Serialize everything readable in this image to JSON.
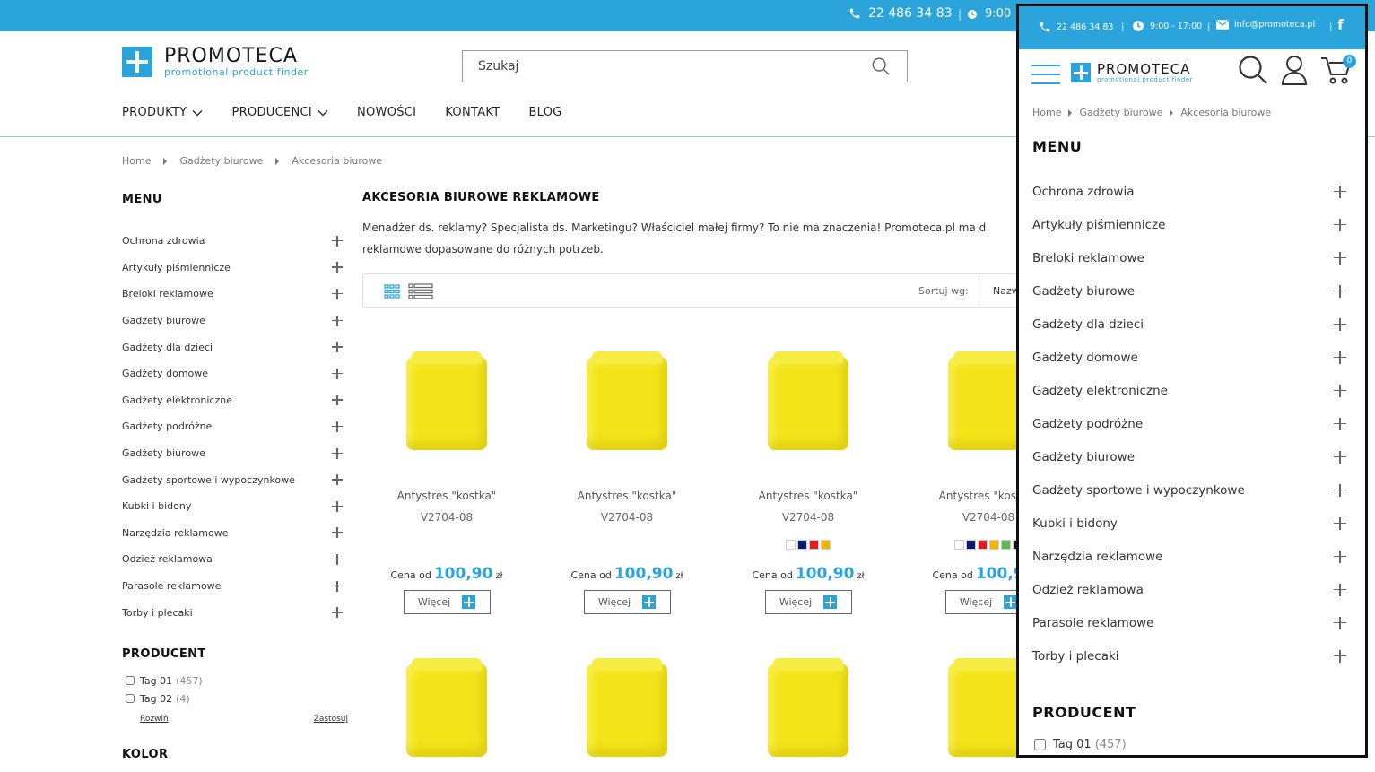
{
  "topbar": {
    "phone": "22 486 34 83",
    "hours": "9:00"
  },
  "logo": {
    "brand": "PROMOTECA",
    "tagline": "promotional product finder"
  },
  "search": {
    "placeholder": "Szukaj"
  },
  "nav": [
    {
      "label": "PRODUKTY",
      "has_dropdown": true
    },
    {
      "label": "PRODUCENCI",
      "has_dropdown": true
    },
    {
      "label": "NOWOŚCI",
      "has_dropdown": false
    },
    {
      "label": "KONTAKT",
      "has_dropdown": false
    },
    {
      "label": "BLOG",
      "has_dropdown": false
    }
  ],
  "breadcrumb": [
    "Home",
    "Gadżety biurowe",
    "Akcesoria biurowe"
  ],
  "sidebar": {
    "title": "MENU",
    "items": [
      "Ochrona zdrowia",
      "Artykuły piśmiennicze",
      "Breloki reklamowe",
      "Gadżety biurowe",
      "Gadżety dla dzieci",
      "Gadżety domowe",
      "Gadżety elektroniczne",
      "Gadżety podróżne",
      "Gadżety biurowe",
      "Gadżety sportowe i wypoczynkowe",
      "Kubki i bidony",
      "Narzędzia reklamowe",
      "Odzież reklamowa",
      "Parasole reklamowe",
      "Torby i plecaki"
    ]
  },
  "producent": {
    "title": "PRODUCENT",
    "tags": [
      {
        "label": "Tag 01",
        "count": "(457)"
      },
      {
        "label": "Tag 02",
        "count": "(4)"
      }
    ],
    "expand": "Rozwiń",
    "apply": "Zastosuj"
  },
  "kolor": {
    "title": "KOLOR"
  },
  "main": {
    "title": "AKCESORIA BIUROWE REKLAMOWE",
    "description": "Menadżer ds. reklamy? Specjalista ds. Marketingu? Właściciel małej firmy? To nie ma znaczenia! Promoteca.pl ma d reklamowe dopasowane do różnych potrzeb."
  },
  "toolbar": {
    "sort_label": "Sortuj wg:",
    "sort_value": "Nazw"
  },
  "products": [
    {
      "name": "Antystres \"kostka\"",
      "code": "V2704-08",
      "price_prefix": "Cena od",
      "price": "100,90",
      "currency": "zł",
      "swatches": [],
      "more": "Więcej"
    },
    {
      "name": "Antystres \"kostka\"",
      "code": "V2704-08",
      "price_prefix": "Cena od",
      "price": "100,90",
      "currency": "zł",
      "swatches": [],
      "more": "Więcej"
    },
    {
      "name": "Antystres \"kostka\"",
      "code": "V2704-08",
      "price_prefix": "Cena od",
      "price": "100,90",
      "currency": "zł",
      "swatches": [
        "#ffffff",
        "#0a1a6e",
        "#e21b1b",
        "#f4b400"
      ],
      "more": "Więcej"
    },
    {
      "name": "Antystres \"kostka\"",
      "code": "V2704-08",
      "price_prefix": "Cena od",
      "price": "100,90",
      "currency": "zł",
      "swatches": [
        "#ffffff",
        "#0a1a6e",
        "#e21b1b",
        "#f4b400",
        "#5cb85c",
        "#111111"
      ],
      "more": "Więcej"
    }
  ],
  "mobile": {
    "phone": "22 486 34 83",
    "hours": "9:00 - 17:00",
    "email": "info@promoteca.pl",
    "cart_count": "0",
    "menu_title": "MENU",
    "producent_title": "PRODUCENT",
    "tag": {
      "label": "Tag 01",
      "count": "(457)"
    }
  },
  "colors": {
    "accent": "#2aa4da",
    "cube_yellow": "#f3e41a"
  }
}
